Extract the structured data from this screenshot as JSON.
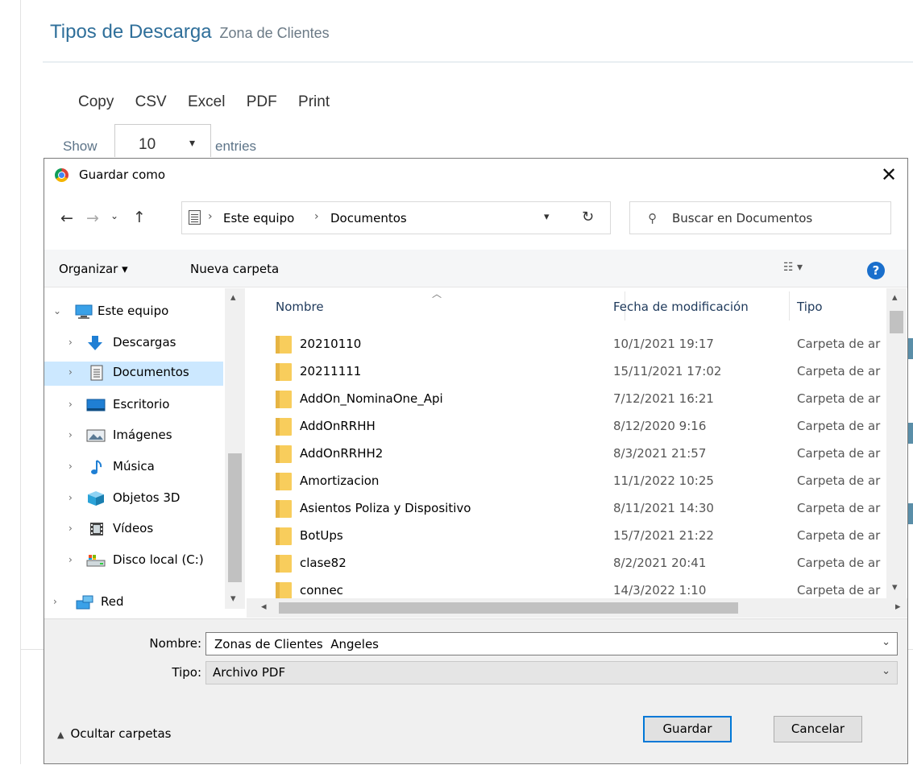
{
  "page": {
    "title": "Tipos de Descarga",
    "subtitle": "Zona de Clientes",
    "export_buttons": [
      "Copy",
      "CSV",
      "Excel",
      "PDF",
      "Print"
    ],
    "show_label": "Show",
    "entries_value": "10",
    "entries_label": "entries"
  },
  "dialog": {
    "title": "Guardar como",
    "breadcrumb": [
      "Este equipo",
      "Documentos"
    ],
    "search_placeholder": "Buscar en Documentos",
    "toolbar": {
      "organize": "Organizar ▾",
      "new_folder": "Nueva carpeta"
    },
    "nav": [
      {
        "label": "Este equipo",
        "icon": "computer-icon",
        "expanded": true
      },
      {
        "label": "Descargas",
        "icon": "downloads-icon"
      },
      {
        "label": "Documentos",
        "icon": "documents-icon",
        "selected": true
      },
      {
        "label": "Escritorio",
        "icon": "desktop-icon"
      },
      {
        "label": "Imágenes",
        "icon": "pictures-icon"
      },
      {
        "label": "Música",
        "icon": "music-icon"
      },
      {
        "label": "Objetos 3D",
        "icon": "3d-objects-icon"
      },
      {
        "label": "Vídeos",
        "icon": "videos-icon"
      },
      {
        "label": "Disco local (C:)",
        "icon": "local-disk-icon"
      },
      {
        "label": "Red",
        "icon": "network-icon"
      }
    ],
    "columns": [
      "Nombre",
      "Fecha de modificación",
      "Tipo"
    ],
    "files": [
      {
        "name": "20210110",
        "date": "10/1/2021 19:17",
        "type": "Carpeta de ar"
      },
      {
        "name": "20211111",
        "date": "15/11/2021 17:02",
        "type": "Carpeta de ar"
      },
      {
        "name": "AddOn_NominaOne_Api",
        "date": "7/12/2021 16:21",
        "type": "Carpeta de ar"
      },
      {
        "name": "AddOnRRHH",
        "date": "8/12/2020 9:16",
        "type": "Carpeta de ar"
      },
      {
        "name": "AddOnRRHH2",
        "date": "8/3/2021 21:57",
        "type": "Carpeta de ar"
      },
      {
        "name": "Amortizacion",
        "date": "11/1/2022 10:25",
        "type": "Carpeta de ar"
      },
      {
        "name": "Asientos Poliza y Dispositivo",
        "date": "8/11/2021 14:30",
        "type": "Carpeta de ar"
      },
      {
        "name": "BotUps",
        "date": "15/7/2021 21:22",
        "type": "Carpeta de ar"
      },
      {
        "name": "clase82",
        "date": "8/2/2021 20:41",
        "type": "Carpeta de ar"
      },
      {
        "name": "connec",
        "date": "14/3/2022 1:10",
        "type": "Carpeta de ar"
      }
    ],
    "filename_label": "Nombre:",
    "filename_value": "Zonas de Clientes  Angeles",
    "filetype_label": "Tipo:",
    "filetype_value": "Archivo PDF",
    "hide_folders": "Ocultar carpetas",
    "save_label": "Guardar",
    "cancel_label": "Cancelar"
  },
  "colors": {
    "page_title": "#2f6f9a",
    "selection": "#cce8ff",
    "primary_border": "#0078d7",
    "help_icon": "#1a6fcc",
    "folder": "#f8cd5c"
  }
}
